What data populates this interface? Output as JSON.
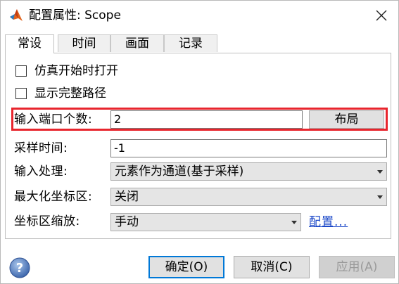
{
  "window": {
    "title": "配置属性: Scope"
  },
  "tabs": [
    {
      "label": "常设",
      "active": true
    },
    {
      "label": "时间",
      "active": false
    },
    {
      "label": "画面",
      "active": false
    },
    {
      "label": "记录",
      "active": false
    }
  ],
  "main": {
    "open_at_start": {
      "label": "仿真开始时打开",
      "checked": false
    },
    "show_full_path": {
      "label": "显示完整路径",
      "checked": false
    },
    "num_ports": {
      "label": "输入端口个数:",
      "value": "2",
      "layout_button": "布局"
    },
    "sample_time": {
      "label": "采样时间:",
      "value": "-1"
    },
    "input_processing": {
      "label": "输入处理:",
      "value": "元素作为通道(基于采样)"
    },
    "maximize_axes": {
      "label": "最大化坐标区:",
      "value": "关闭"
    },
    "axes_scaling": {
      "label": "坐标区缩放:",
      "value": "手动",
      "configure_link": "配置..."
    }
  },
  "footer": {
    "ok": "确定(O)",
    "cancel": "取消(C)",
    "apply": "应用(A)"
  },
  "colors": {
    "highlight": "#e8252d",
    "link": "#1a47c8",
    "primary": "#0078d7"
  },
  "icons": {
    "app": "matlab-icon",
    "help": "help-icon",
    "close": "close-icon"
  }
}
